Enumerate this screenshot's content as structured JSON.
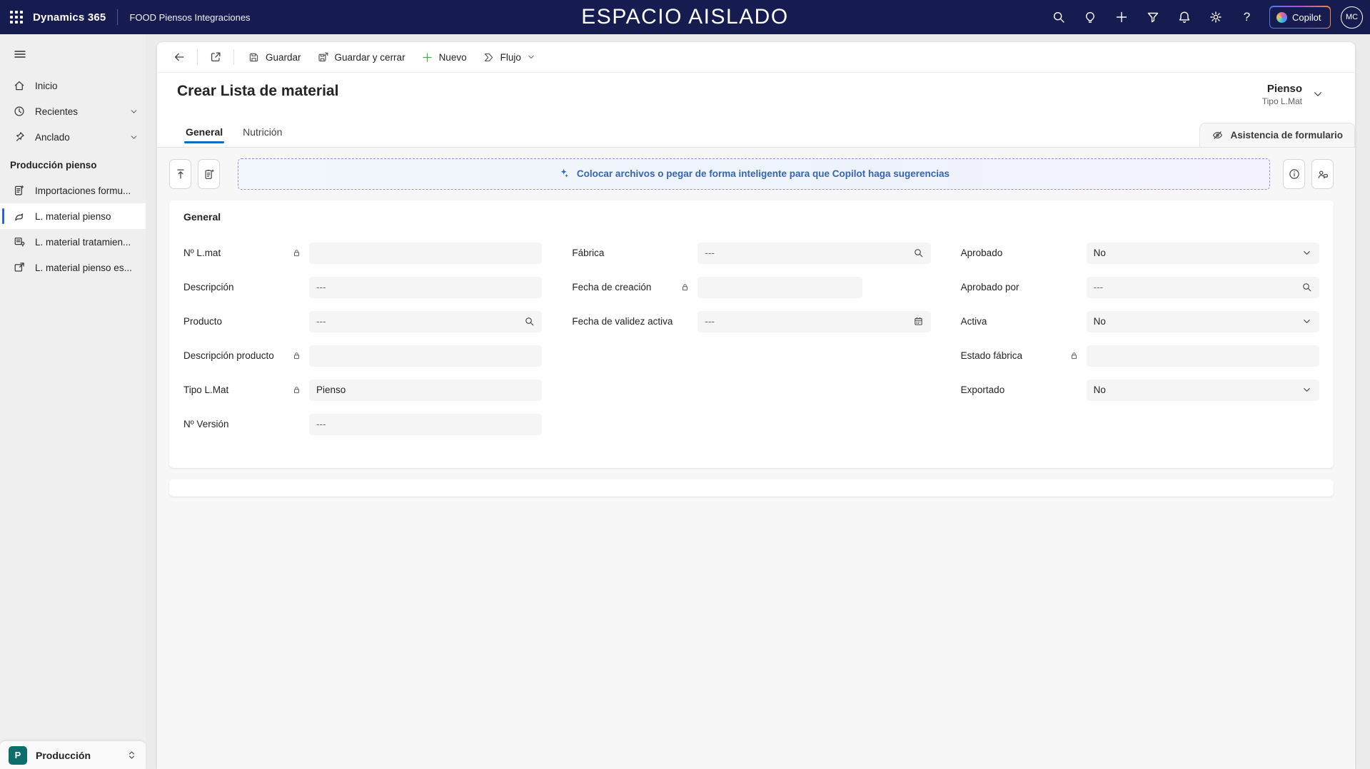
{
  "topbar": {
    "product": "Dynamics 365",
    "app_name": "FOOD Piensos Integraciones",
    "banner": "ESPACIO AISLADO",
    "action_icons": [
      "search",
      "lightbulb",
      "plus",
      "filter",
      "bell",
      "gear",
      "help"
    ],
    "copilot_label": "Copilot",
    "avatar_initials": "MC"
  },
  "sidebar": {
    "items": [
      {
        "label": "Inicio",
        "icon": "home",
        "chevron": false,
        "selected": false
      },
      {
        "label": "Recientes",
        "icon": "clock",
        "chevron": true,
        "selected": false
      },
      {
        "label": "Anclado",
        "icon": "pin",
        "chevron": true,
        "selected": false
      }
    ],
    "section_title": "Producción pienso",
    "section_items": [
      {
        "label": "Importaciones formu...",
        "icon": "document-add",
        "selected": false
      },
      {
        "label": "L. material pienso",
        "icon": "bird",
        "selected": true
      },
      {
        "label": "L. material tratamien...",
        "icon": "box-settings",
        "selected": false
      },
      {
        "label": "L. material pienso es...",
        "icon": "box-arrow",
        "selected": false
      }
    ],
    "environment": {
      "initial": "P",
      "label": "Producción"
    }
  },
  "command_bar": {
    "buttons": [
      {
        "label": "Guardar",
        "icon": "save",
        "chevron": false,
        "green": false
      },
      {
        "label": "Guardar y cerrar",
        "icon": "save-close",
        "chevron": false,
        "green": false
      },
      {
        "label": "Nuevo",
        "icon": "plus",
        "chevron": false,
        "green": true
      },
      {
        "label": "Flujo",
        "icon": "flow",
        "chevron": true,
        "green": false
      }
    ]
  },
  "page": {
    "title": "Crear Lista de material",
    "record_value": "Pienso",
    "record_label": "Tipo L.Mat",
    "tabs": [
      {
        "label": "General",
        "active": true
      },
      {
        "label": "Nutrición",
        "active": false
      }
    ],
    "assistant_label": "Asistencia de formulario",
    "copilot_banner": "Colocar archivos o pegar de forma inteligente para que Copilot haga sugerencias"
  },
  "form": {
    "section_title": "General",
    "columns": [
      [
        {
          "label": "Nº L.mat",
          "locked": true,
          "type": "text",
          "value": "",
          "placeholder": ""
        },
        {
          "label": "Descripción",
          "locked": false,
          "type": "text",
          "value": "",
          "placeholder": "---"
        },
        {
          "label": "Producto",
          "locked": false,
          "type": "lookup",
          "value": "",
          "placeholder": "---"
        },
        {
          "label": "Descripción producto",
          "locked": true,
          "type": "text",
          "value": "",
          "placeholder": ""
        },
        {
          "label": "Tipo L.Mat",
          "locked": true,
          "type": "text",
          "value": "Pienso",
          "placeholder": ""
        },
        {
          "label": "Nº Versión",
          "locked": false,
          "type": "text",
          "value": "",
          "placeholder": "---"
        }
      ],
      [
        {
          "label": "Fábrica",
          "locked": false,
          "type": "lookup",
          "value": "",
          "placeholder": "---"
        },
        {
          "label": "Fecha de creación",
          "locked": true,
          "type": "text",
          "value": "",
          "placeholder": "",
          "short": true
        },
        {
          "label": "Fecha de validez activa",
          "locked": false,
          "type": "date",
          "value": "",
          "placeholder": "---"
        }
      ],
      [
        {
          "label": "Aprobado",
          "locked": false,
          "type": "dropdown",
          "value": "No",
          "placeholder": ""
        },
        {
          "label": "Aprobado por",
          "locked": false,
          "type": "lookup",
          "value": "",
          "placeholder": "---"
        },
        {
          "label": "Activa",
          "locked": false,
          "type": "dropdown",
          "value": "No",
          "placeholder": ""
        },
        {
          "label": "Estado fábrica",
          "locked": true,
          "type": "text",
          "value": "",
          "placeholder": ""
        },
        {
          "label": "Exportado",
          "locked": false,
          "type": "dropdown",
          "value": "No",
          "placeholder": ""
        }
      ]
    ]
  },
  "colors": {
    "topbar": "#171c50",
    "accent": "#0f6cbd",
    "selected_bar": "#2266e3",
    "copilot_text": "#3565b5",
    "new_green": "#54a254",
    "env_teal": "#0e6e6b"
  }
}
